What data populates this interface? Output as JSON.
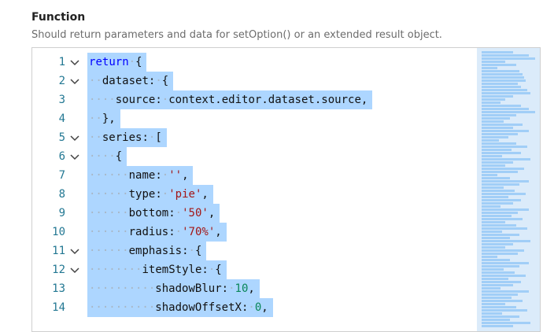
{
  "section": {
    "title": "Function",
    "description": "Should return parameters and data for setOption() or an extended result object."
  },
  "editor": {
    "lines": [
      {
        "num": "1",
        "fold": true,
        "indent": 0,
        "tokens": [
          [
            "kw",
            "return"
          ],
          [
            "p",
            " {"
          ]
        ]
      },
      {
        "num": "2",
        "fold": true,
        "indent": 1,
        "tokens": [
          [
            "p",
            "dataset: {"
          ]
        ]
      },
      {
        "num": "3",
        "fold": false,
        "indent": 2,
        "tokens": [
          [
            "p",
            "source: context.editor.dataset.source,"
          ]
        ]
      },
      {
        "num": "4",
        "fold": false,
        "indent": 1,
        "tokens": [
          [
            "p",
            "},"
          ]
        ]
      },
      {
        "num": "5",
        "fold": true,
        "indent": 1,
        "tokens": [
          [
            "p",
            "series: ["
          ]
        ]
      },
      {
        "num": "6",
        "fold": true,
        "indent": 2,
        "tokens": [
          [
            "p",
            "{"
          ]
        ]
      },
      {
        "num": "7",
        "fold": false,
        "indent": 3,
        "tokens": [
          [
            "p",
            "name: "
          ],
          [
            "str",
            "''"
          ],
          [
            "p",
            ","
          ]
        ]
      },
      {
        "num": "8",
        "fold": false,
        "indent": 3,
        "tokens": [
          [
            "p",
            "type: "
          ],
          [
            "str",
            "'pie'"
          ],
          [
            "p",
            ","
          ]
        ]
      },
      {
        "num": "9",
        "fold": false,
        "indent": 3,
        "tokens": [
          [
            "p",
            "bottom: "
          ],
          [
            "str",
            "'50'"
          ],
          [
            "p",
            ","
          ]
        ]
      },
      {
        "num": "10",
        "fold": false,
        "indent": 3,
        "tokens": [
          [
            "p",
            "radius: "
          ],
          [
            "str",
            "'70%'"
          ],
          [
            "p",
            ","
          ]
        ]
      },
      {
        "num": "11",
        "fold": true,
        "indent": 3,
        "tokens": [
          [
            "p",
            "emphasis: {"
          ]
        ]
      },
      {
        "num": "12",
        "fold": true,
        "indent": 4,
        "tokens": [
          [
            "p",
            "itemStyle: {"
          ]
        ]
      },
      {
        "num": "13",
        "fold": false,
        "indent": 5,
        "tokens": [
          [
            "p",
            "shadowBlur: "
          ],
          [
            "num",
            "10"
          ],
          [
            "p",
            ","
          ]
        ]
      },
      {
        "num": "14",
        "fold": false,
        "indent": 5,
        "tokens": [
          [
            "p",
            "shadowOffsetX: "
          ],
          [
            "num",
            "0"
          ],
          [
            "p",
            ","
          ]
        ]
      }
    ]
  },
  "colors": {
    "selection": "#add6ff",
    "keyword": "#0000ff",
    "string": "#a31515",
    "number": "#098658",
    "line_number": "#237893"
  }
}
